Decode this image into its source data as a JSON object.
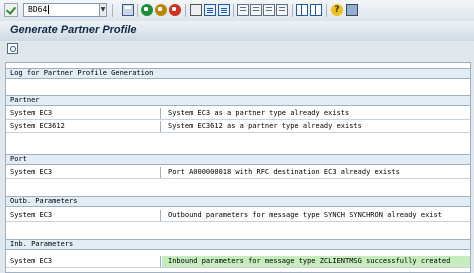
{
  "toolbar": {
    "command_value": "BD64",
    "icons": [
      "enter-icon",
      "save-icon",
      "back-icon",
      "exit-icon",
      "cancel-icon",
      "print-icon",
      "find-icon",
      "find-next-icon",
      "first-page-icon",
      "previous-page-icon",
      "next-page-icon",
      "last-page-icon",
      "create-session-icon",
      "shortcut-icon",
      "help-icon",
      "customize-layout-icon"
    ]
  },
  "title": "Generate Partner Profile",
  "app_toolbar": {
    "icons": [
      "find-in-log-icon"
    ]
  },
  "log": {
    "header": "Log for Partner Profile Generation",
    "sections": [
      {
        "title": "Partner",
        "rows": [
          {
            "object": "System EC3",
            "message": "System EC3 as a partner type already exists",
            "status": "info"
          },
          {
            "object": "System EC3612",
            "message": "System EC3612 as a partner type already exists",
            "status": "info"
          }
        ]
      },
      {
        "title": "Port",
        "rows": [
          {
            "object": "System EC3",
            "message": "Port A000000018 with RFC destination EC3 already exists",
            "status": "info"
          }
        ]
      },
      {
        "title": "Outb. Parameters",
        "rows": [
          {
            "object": "System EC3",
            "message": "Outbound parameters for message type SYNCH SYNCHRON already exist",
            "status": "info"
          }
        ]
      },
      {
        "title": "Inb. Parameters",
        "rows": [
          {
            "object": "System EC3",
            "message": "Inbound parameters for message type ZCLIENTMSG successfully created",
            "status": "success"
          }
        ]
      }
    ]
  },
  "colors": {
    "success_bg": "#c6ecbe",
    "header_bg": "#e2ecf5",
    "frame_bg": "#dfe6ec"
  }
}
